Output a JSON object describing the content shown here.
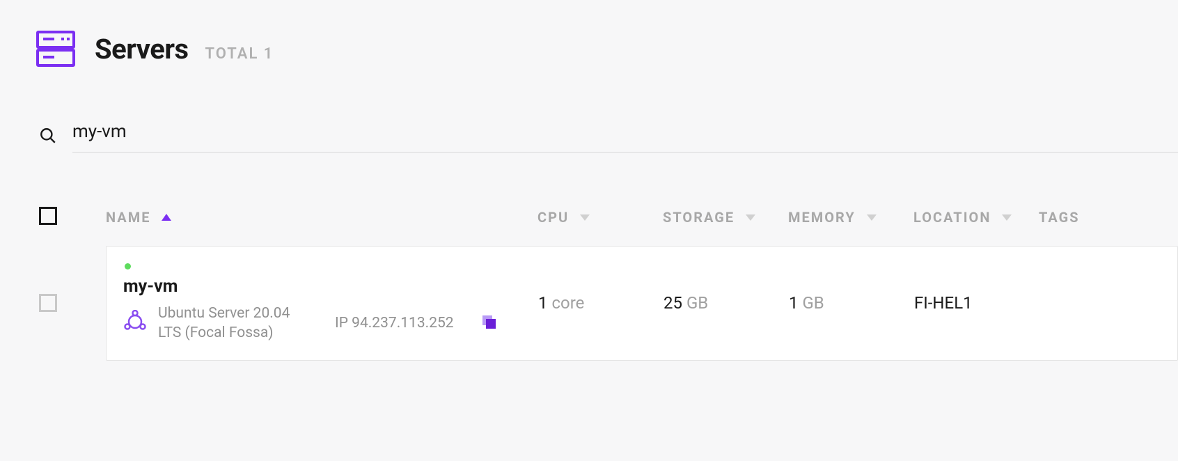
{
  "page": {
    "title": "Servers",
    "total_label": "TOTAL 1"
  },
  "search": {
    "value": "my-vm"
  },
  "columns": {
    "name": "NAME",
    "cpu": "CPU",
    "storage": "STORAGE",
    "memory": "MEMORY",
    "location": "LOCATION",
    "tags": "TAGS"
  },
  "servers": [
    {
      "status": "running",
      "name": "my-vm",
      "os": "Ubuntu Server 20.04 LTS (Focal Fossa)",
      "ip_label": "IP 94.237.113.252",
      "cpu_value": "1",
      "cpu_unit": "core",
      "storage_value": "25",
      "storage_unit": "GB",
      "memory_value": "1",
      "memory_unit": "GB",
      "location": "FI-HEL1",
      "tags": ""
    }
  ]
}
